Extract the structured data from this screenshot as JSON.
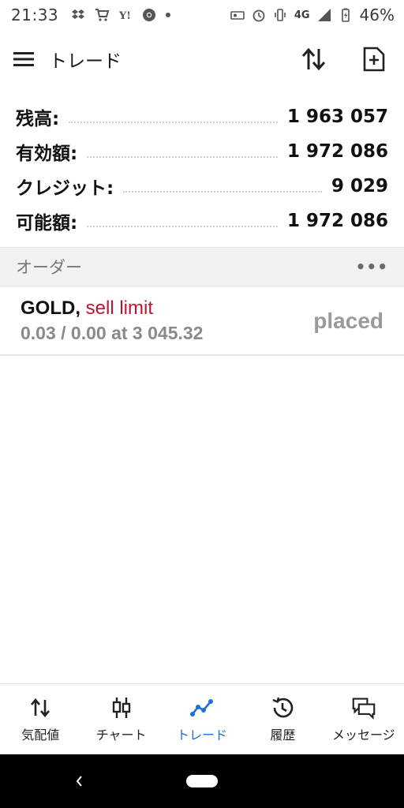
{
  "status_bar": {
    "time": "21:33",
    "left_icons": [
      "dropbox-icon",
      "cart-icon",
      "yahoo-icon",
      "chrome-icon",
      "dot-icon"
    ],
    "network": "4G",
    "battery_percent": "46%"
  },
  "app_bar": {
    "title": "トレード",
    "actions": [
      "sort-icon",
      "new-order-icon"
    ]
  },
  "account": {
    "rows": [
      {
        "label": "残高:",
        "value": "1 963 057"
      },
      {
        "label": "有効額:",
        "value": "1 972 086"
      },
      {
        "label": "クレジット:",
        "value": "9 029"
      },
      {
        "label": "可能額:",
        "value": "1 972 086"
      }
    ]
  },
  "orders_section": {
    "title": "オーダー",
    "more": "•••"
  },
  "orders": [
    {
      "symbol": "GOLD,",
      "type": "sell limit",
      "details": "0.03 / 0.00 at 3 045.32",
      "state": "placed"
    }
  ],
  "colors": {
    "accent": "#1e6fd9",
    "sell": "#c8102e",
    "muted": "#8a8a8a"
  },
  "bottom_nav": {
    "items": [
      {
        "label": "気配値",
        "icon": "quotes-icon",
        "active": false
      },
      {
        "label": "チャート",
        "icon": "chart-icon",
        "active": false
      },
      {
        "label": "トレード",
        "icon": "trade-icon",
        "active": true
      },
      {
        "label": "履歴",
        "icon": "history-icon",
        "active": false
      },
      {
        "label": "メッセージ",
        "icon": "messages-icon",
        "active": false
      }
    ]
  }
}
